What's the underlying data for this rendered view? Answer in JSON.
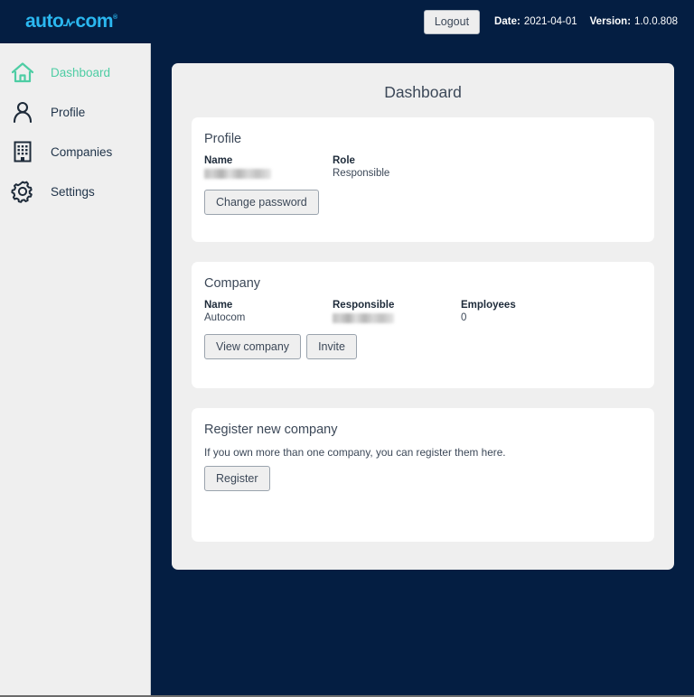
{
  "header": {
    "logo_text_left": "auto",
    "logo_text_right": "com",
    "logo_tm": "®",
    "logout_label": "Logout",
    "date_label": "Date:",
    "date_value": "2021-04-01",
    "version_label": "Version:",
    "version_value": "1.0.0.808",
    "brand_color": "#2bb8f0",
    "bg_color": "#041e42"
  },
  "sidebar": {
    "active_color": "#4ecda4",
    "items": [
      {
        "label": "Dashboard",
        "icon": "home-icon",
        "active": true
      },
      {
        "label": "Profile",
        "icon": "person-icon",
        "active": false
      },
      {
        "label": "Companies",
        "icon": "building-icon",
        "active": false
      },
      {
        "label": "Settings",
        "icon": "gear-icon",
        "active": false
      }
    ]
  },
  "main": {
    "page_title": "Dashboard",
    "profile_card": {
      "title": "Profile",
      "name_label": "Name",
      "name_value": "",
      "name_redacted": true,
      "role_label": "Role",
      "role_value": "Responsible",
      "change_password_label": "Change password"
    },
    "company_card": {
      "title": "Company",
      "name_label": "Name",
      "name_value": "Autocom",
      "responsible_label": "Responsible",
      "responsible_value": "",
      "responsible_redacted": true,
      "employees_label": "Employees",
      "employees_value": "0",
      "view_company_label": "View company",
      "invite_label": "Invite"
    },
    "register_card": {
      "title": "Register new company",
      "description": "If you own more than one company, you can register them here.",
      "register_label": "Register"
    }
  }
}
